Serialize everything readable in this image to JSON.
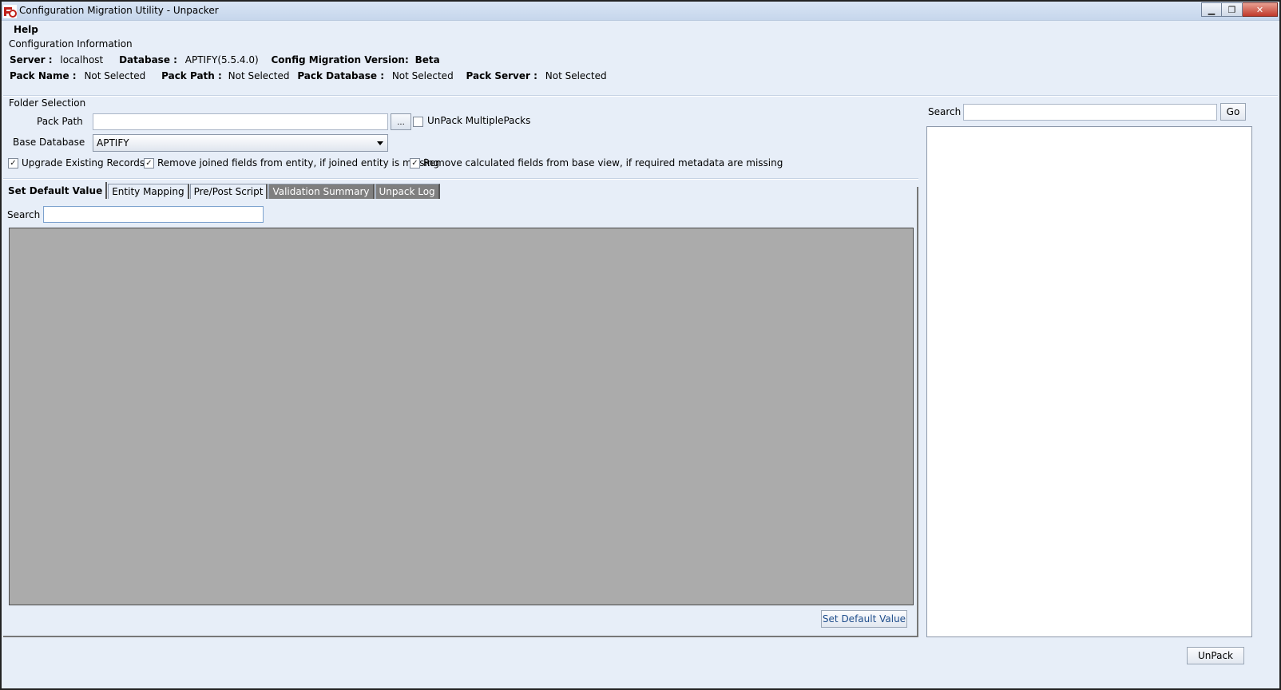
{
  "window": {
    "title": "Configuration Migration Utility - Unpacker",
    "minimize_glyph": "▁",
    "restore_glyph": "❐",
    "close_glyph": "✕"
  },
  "menu": {
    "help": "Help"
  },
  "config_info": {
    "group_label": "Configuration Information",
    "server_label": "Server :",
    "server_value": "localhost",
    "database_label": "Database :",
    "database_value": "APTIFY(5.5.4.0)",
    "version_label": "Config Migration Version:",
    "version_value": "Beta",
    "pack_name_label": "Pack Name :",
    "pack_name_value": "Not Selected",
    "pack_path_label": "Pack Path :",
    "pack_path_value": "Not Selected",
    "pack_database_label": "Pack Database :",
    "pack_database_value": "Not Selected",
    "pack_server_label": "Pack Server :",
    "pack_server_value": "Not Selected"
  },
  "folder_selection": {
    "group_label": "Folder Selection",
    "pack_path_label": "Pack Path",
    "pack_path_value": "",
    "browse_label": "...",
    "unpack_multiple_label": "UnPack MultiplePacks",
    "unpack_multiple_checked": false,
    "base_database_label": "Base Database",
    "base_database_value": "APTIFY"
  },
  "options": {
    "upgrade_existing": {
      "label": "Upgrade Existing Records",
      "checked": true
    },
    "remove_joined": {
      "label": "Remove joined fields from entity, if joined entity is missing",
      "checked": true
    },
    "remove_calculated": {
      "label": "Remove calculated fields from base view, if required metadata are missing",
      "checked": true
    },
    "check_glyph": "✓"
  },
  "tabs": [
    {
      "label": "Set Default Value",
      "state": "active"
    },
    {
      "label": "Entity Mapping",
      "state": "normal"
    },
    {
      "label": "Pre/Post Script",
      "state": "normal"
    },
    {
      "label": "Validation Summary",
      "state": "disabled"
    },
    {
      "label": "Unpack Log",
      "state": "disabled"
    }
  ],
  "left_panel": {
    "search_label": "Search",
    "search_value": "",
    "set_default_button": "Set Default Value"
  },
  "right_panel": {
    "search_label": "Search",
    "search_value": "",
    "go_button": "Go"
  },
  "footer": {
    "unpack_button": "UnPack"
  },
  "colors": {
    "window_bg": "#e7eef8",
    "grid_bg": "#ababab",
    "disabled_tab": "#7f7f7f"
  }
}
